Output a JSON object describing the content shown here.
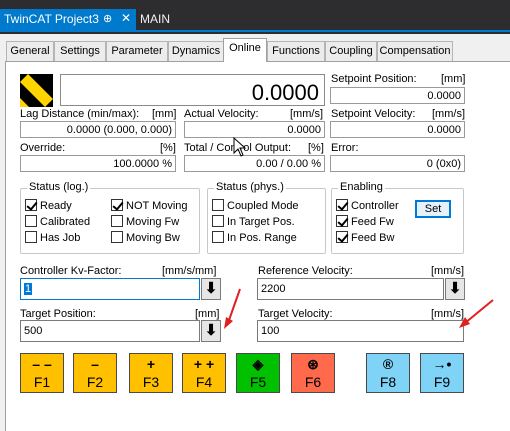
{
  "tabs": {
    "active_doc": "TwinCAT Project3",
    "active_doc_pin": "⊕",
    "active_doc_close": "✕",
    "second_doc": "MAIN"
  },
  "property_tabs": [
    "General",
    "Settings",
    "Parameter",
    "Dynamics",
    "Online",
    "Functions",
    "Coupling",
    "Compensation"
  ],
  "online": {
    "position_value": "0.0000",
    "setpoint_position_label": "Setpoint Position:",
    "setpoint_position_unit": "[mm]",
    "setpoint_position_value": "0.0000",
    "lag_distance_label": "Lag Distance (min/max):",
    "lag_distance_unit": "[mm]",
    "lag_distance_value": "0.0000  (0.000, 0.000)",
    "actual_velocity_label": "Actual Velocity:",
    "actual_velocity_unit": "[mm/s]",
    "actual_velocity_value": "0.0000",
    "setpoint_velocity_label": "Setpoint Velocity:",
    "setpoint_velocity_unit": "[mm/s]",
    "setpoint_velocity_value": "0.0000",
    "override_label": "Override:",
    "override_unit": "[%]",
    "override_value": "100.0000 %",
    "total_output_label": "Total / Control Output:",
    "total_output_unit": "[%]",
    "total_output_value": "0.00 /  0.00 %",
    "error_label": "Error:",
    "error_value": "0 (0x0)"
  },
  "status_log": {
    "title": "Status (log.)",
    "items": [
      {
        "label": "Ready",
        "checked": true
      },
      {
        "label": "Calibrated",
        "checked": false
      },
      {
        "label": "Has Job",
        "checked": false
      },
      {
        "label": "NOT Moving",
        "checked": true
      },
      {
        "label": "Moving Fw",
        "checked": false
      },
      {
        "label": "Moving Bw",
        "checked": false
      }
    ]
  },
  "status_phys": {
    "title": "Status (phys.)",
    "items": [
      {
        "label": "Coupled Mode",
        "checked": false
      },
      {
        "label": "In Target Pos.",
        "checked": false
      },
      {
        "label": "In Pos. Range",
        "checked": false
      }
    ]
  },
  "enabling": {
    "title": "Enabling",
    "items": [
      {
        "label": "Controller",
        "checked": true
      },
      {
        "label": "Feed Fw",
        "checked": true
      },
      {
        "label": "Feed Bw",
        "checked": true
      }
    ],
    "set_label": "Set"
  },
  "controls": {
    "kv_label": "Controller Kv-Factor:",
    "kv_unit": "[mm/s/mm]",
    "kv_value": "1",
    "ref_vel_label": "Reference Velocity:",
    "ref_vel_unit": "[mm/s]",
    "ref_vel_value": "2200",
    "target_pos_label": "Target Position:",
    "target_pos_unit": "[mm]",
    "target_pos_value": "500",
    "target_vel_label": "Target Velocity:",
    "target_vel_unit": "[mm/s]",
    "target_vel_value": "100",
    "download_glyph": "⬇"
  },
  "function_buttons": [
    {
      "sym": "– –",
      "label": "F1",
      "color": "#ffc000"
    },
    {
      "sym": "–",
      "label": "F2",
      "color": "#ffc000"
    },
    {
      "sym": "+",
      "label": "F3",
      "color": "#ffc000"
    },
    {
      "sym": "+ +",
      "label": "F4",
      "color": "#ffc000"
    },
    {
      "sym": "◈",
      "label": "F5",
      "color": "#00c000"
    },
    {
      "sym": "⊛",
      "label": "F6",
      "color": "#ff6a4d"
    },
    {
      "sym": "®",
      "label": "F8",
      "color": "#7fd3f7"
    },
    {
      "sym": "→•",
      "label": "F9",
      "color": "#7fd3f7"
    }
  ],
  "colors": {
    "accent": "#007acc",
    "annotation_arrow": "#e02020"
  }
}
